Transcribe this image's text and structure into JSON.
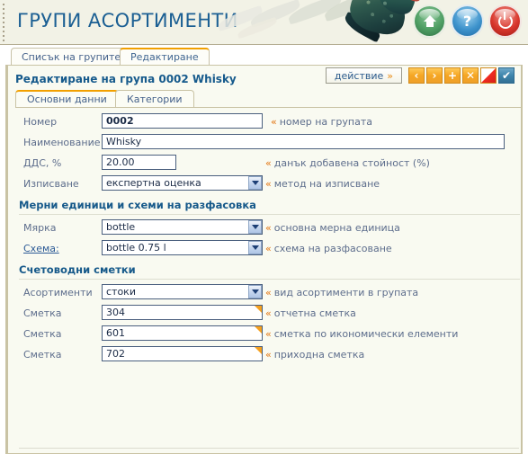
{
  "header": {
    "title": "ГРУПИ АСОРТИМЕНТИ",
    "buttons": [
      {
        "name": "home-button",
        "icon": "home-icon",
        "color": "#4e9e63"
      },
      {
        "name": "help-button",
        "icon": "question-icon",
        "label": "?",
        "color": "#3e93cc"
      },
      {
        "name": "logout-button",
        "icon": "power-icon",
        "color": "#d8362c"
      }
    ]
  },
  "outer_tabs": [
    {
      "label": "Списък на групите",
      "active": false
    },
    {
      "label": "Редактиране",
      "active": true
    }
  ],
  "panel": {
    "title": "Редактиране на група 0002 Whisky",
    "toolbar": {
      "action_label": "действие",
      "action_chevron": "»",
      "icons": [
        {
          "name": "prev-button",
          "glyph": "‹",
          "style": "orange"
        },
        {
          "name": "next-button",
          "glyph": "›",
          "style": "orange"
        },
        {
          "name": "add-button",
          "glyph": "+",
          "style": "orange"
        },
        {
          "name": "delete-button",
          "glyph": "✕",
          "style": "orange"
        },
        {
          "name": "cancel-button",
          "glyph": "",
          "style": "red"
        },
        {
          "name": "confirm-button",
          "glyph": "✔",
          "style": "blue"
        }
      ]
    },
    "inner_tabs": [
      {
        "label": "Основни данни",
        "active": true
      },
      {
        "label": "Категории",
        "active": false
      }
    ],
    "fields": {
      "number": {
        "label": "Номер",
        "value": "0002",
        "hint": "номер на групата"
      },
      "name": {
        "label": "Наименование",
        "value": "Whisky",
        "hint": ""
      },
      "vat": {
        "label": "ДДС, %",
        "value": "20.00",
        "hint": "данък добавена стойност (%)"
      },
      "writeoff": {
        "label": "Изписване",
        "value": "експертна оценка",
        "hint": "метод на изписване"
      },
      "unit": {
        "label": "Мярка",
        "value": "bottle",
        "hint": "основна мерна единица"
      },
      "scheme": {
        "label": "Схема:",
        "value": "bottle 0.75 l",
        "hint": "схема на разфасоване"
      },
      "assortment": {
        "label": "Асортименти",
        "value": "стоки",
        "hint": "вид асортименти в групата"
      },
      "account1": {
        "label": "Сметка",
        "value": "304",
        "hint": "отчетна сметка"
      },
      "account2": {
        "label": "Сметка",
        "value": "601",
        "hint": "сметка по икономически елементи"
      },
      "account3": {
        "label": "Сметка",
        "value": "702",
        "hint": "приходна сметка"
      }
    },
    "sections": {
      "units": "Мерни единици и схеми на разфасовка",
      "accounts": "Счетоводни сметки"
    }
  },
  "colors": {
    "accent_orange": "#f2a000",
    "title_blue": "#16598a",
    "label_blue": "#5d6d8c",
    "panel_bg": "#f9faf1",
    "header_bg": "#f2f2e6"
  }
}
